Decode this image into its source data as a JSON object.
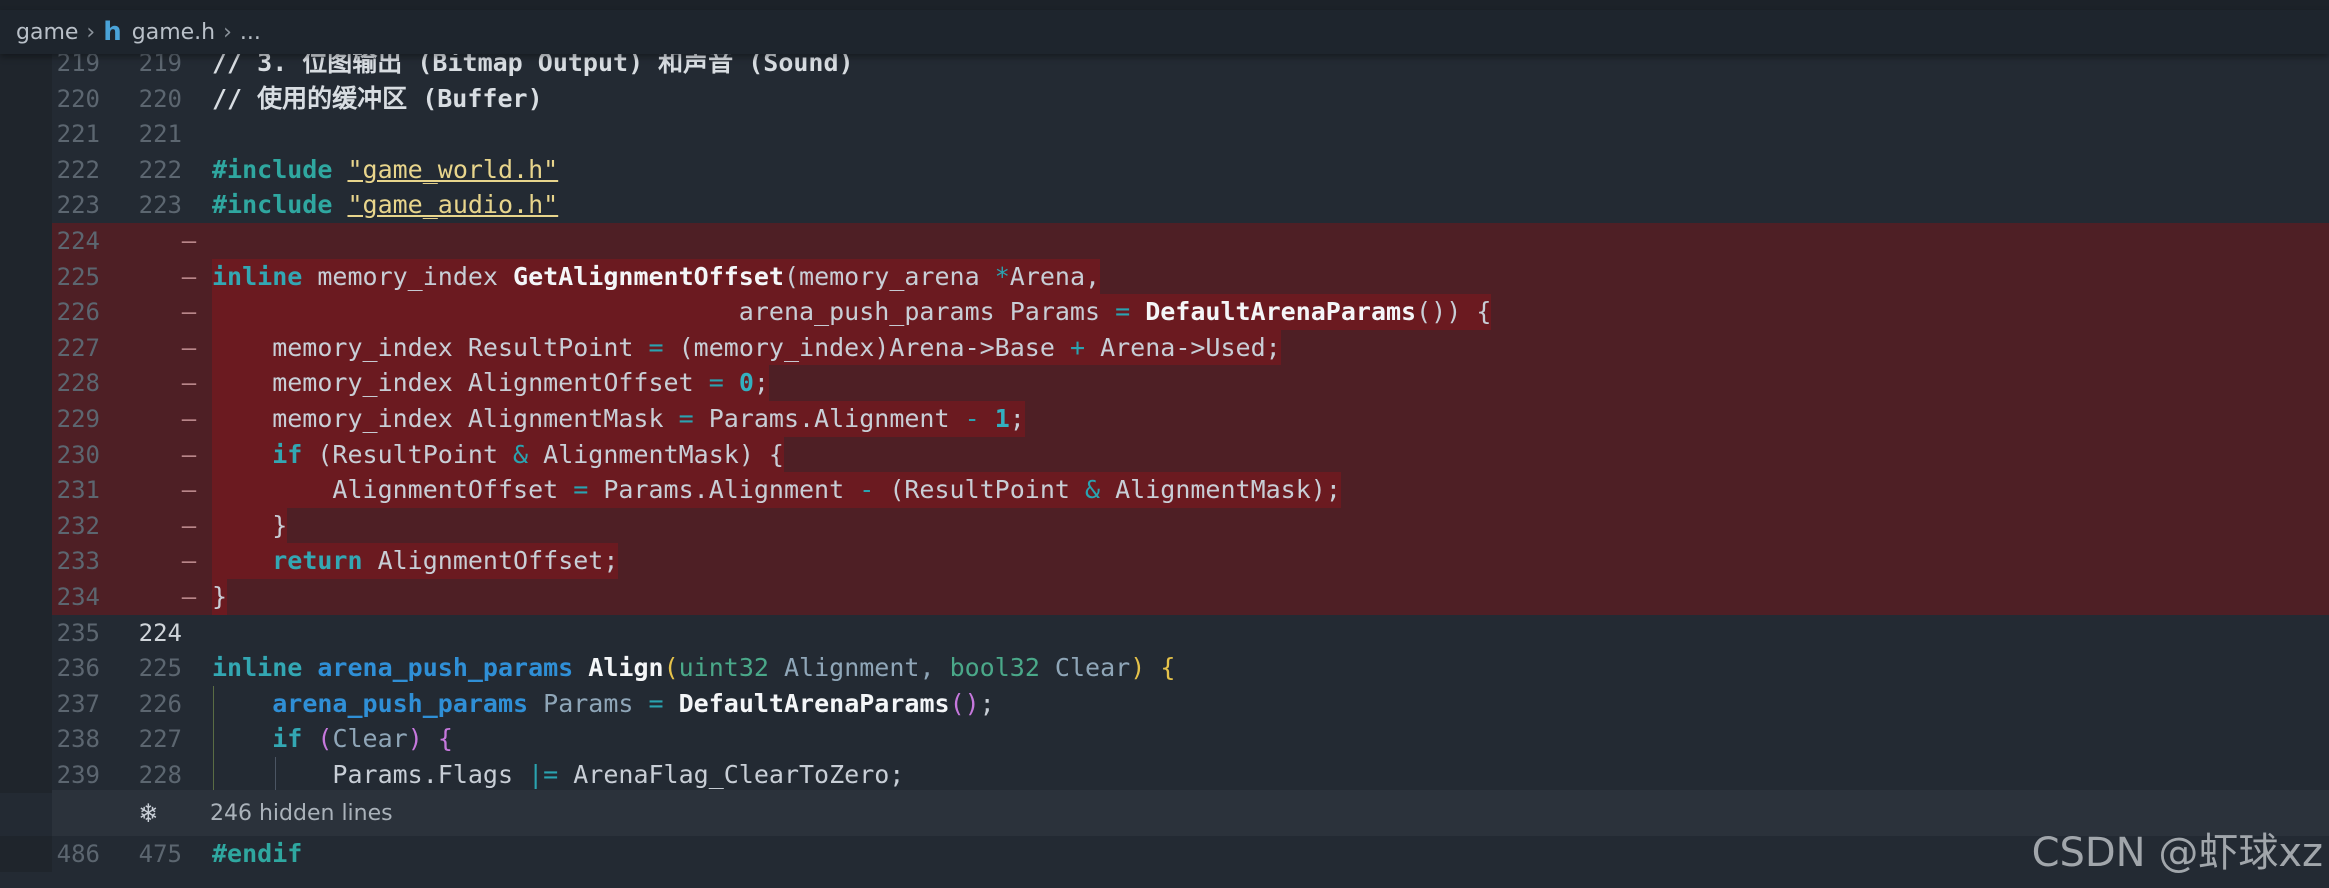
{
  "breadcrumb": {
    "folder": "game",
    "file_icon": "h",
    "file": "game.h",
    "ellipsis": "..."
  },
  "diff_lines": [
    {
      "old": "219",
      "new": "219",
      "type": "ctx",
      "tokens": [
        [
          "cm",
          "// 3. 位图输出 (Bitmap Output) 和声音 (Sound)"
        ]
      ]
    },
    {
      "old": "220",
      "new": "220",
      "type": "ctx",
      "tokens": [
        [
          "cm",
          "// 使用的缓冲区 (Buffer)"
        ]
      ]
    },
    {
      "old": "221",
      "new": "221",
      "type": "ctx",
      "tokens": []
    },
    {
      "old": "222",
      "new": "222",
      "type": "ctx",
      "tokens": [
        [
          "pp",
          "#include "
        ],
        [
          "str",
          "\"game_world.h\""
        ]
      ]
    },
    {
      "old": "223",
      "new": "223",
      "type": "ctx",
      "tokens": [
        [
          "pp",
          "#include "
        ],
        [
          "str",
          "\"game_audio.h\""
        ]
      ]
    },
    {
      "old": "224",
      "new": "—",
      "type": "del",
      "tokens": []
    },
    {
      "old": "225",
      "new": "—",
      "type": "del",
      "tokens": [
        [
          "kw",
          "inline "
        ],
        [
          "id",
          "memory_index "
        ],
        [
          "fn",
          "GetAlignmentOffset"
        ],
        [
          "id",
          "(memory_arena "
        ],
        [
          "op",
          "*"
        ],
        [
          "id",
          "Arena,"
        ]
      ]
    },
    {
      "old": "226",
      "new": "—",
      "type": "del",
      "tokens": [
        [
          "id",
          "                                   arena_push_params Params "
        ],
        [
          "op",
          "= "
        ],
        [
          "fn",
          "DefaultArenaParams"
        ],
        [
          "id",
          "()) {"
        ]
      ]
    },
    {
      "old": "227",
      "new": "—",
      "type": "del",
      "tokens": [
        [
          "id",
          "    memory_index ResultPoint "
        ],
        [
          "op",
          "= "
        ],
        [
          "id",
          "(memory_index)Arena->Base "
        ],
        [
          "op",
          "+ "
        ],
        [
          "id",
          "Arena->Used;"
        ]
      ]
    },
    {
      "old": "228",
      "new": "—",
      "type": "del",
      "tokens": [
        [
          "id",
          "    memory_index AlignmentOffset "
        ],
        [
          "op",
          "= "
        ],
        [
          "num",
          "0"
        ],
        [
          "id",
          ";"
        ]
      ]
    },
    {
      "old": "229",
      "new": "—",
      "type": "del",
      "tokens": [
        [
          "id",
          "    memory_index AlignmentMask "
        ],
        [
          "op",
          "= "
        ],
        [
          "id",
          "Params.Alignment "
        ],
        [
          "op",
          "- "
        ],
        [
          "num",
          "1"
        ],
        [
          "id",
          ";"
        ]
      ]
    },
    {
      "old": "230",
      "new": "—",
      "type": "del",
      "tokens": [
        [
          "id",
          "    "
        ],
        [
          "kw",
          "if "
        ],
        [
          "id",
          "(ResultPoint "
        ],
        [
          "op",
          "& "
        ],
        [
          "id",
          "AlignmentMask) {"
        ]
      ]
    },
    {
      "old": "231",
      "new": "—",
      "type": "del",
      "tokens": [
        [
          "id",
          "        AlignmentOffset "
        ],
        [
          "op",
          "= "
        ],
        [
          "id",
          "Params.Alignment "
        ],
        [
          "op",
          "- "
        ],
        [
          "id",
          "(ResultPoint "
        ],
        [
          "op",
          "& "
        ],
        [
          "id",
          "AlignmentMask);"
        ]
      ]
    },
    {
      "old": "232",
      "new": "—",
      "type": "del",
      "tokens": [
        [
          "id",
          "    }"
        ]
      ]
    },
    {
      "old": "233",
      "new": "—",
      "type": "del",
      "tokens": [
        [
          "id",
          "    "
        ],
        [
          "kw",
          "return "
        ],
        [
          "id",
          "AlignmentOffset;"
        ]
      ]
    },
    {
      "old": "234",
      "new": "—",
      "type": "del",
      "tokens": [
        [
          "id",
          "}"
        ]
      ]
    },
    {
      "old": "235",
      "new": "224",
      "type": "ctx",
      "current": true,
      "tokens": []
    },
    {
      "old": "236",
      "new": "225",
      "type": "ctx",
      "tokens": [
        [
          "kw",
          "inline "
        ],
        [
          "ty",
          "arena_push_params "
        ],
        [
          "fn",
          "Align"
        ],
        [
          "brk1",
          "("
        ],
        [
          "prim",
          "uint32 "
        ],
        [
          "param",
          "Alignment, "
        ],
        [
          "prim",
          "bool32 "
        ],
        [
          "param",
          "Clear"
        ],
        [
          "brk1",
          ")"
        ],
        [
          "id",
          " "
        ],
        [
          "brk1",
          "{"
        ]
      ]
    },
    {
      "old": "237",
      "new": "226",
      "type": "ctx",
      "tokens": [
        [
          "id",
          "    "
        ],
        [
          "ty",
          "arena_push_params "
        ],
        [
          "param",
          "Params "
        ],
        [
          "op",
          "= "
        ],
        [
          "fn",
          "DefaultArenaParams"
        ],
        [
          "brk2",
          "()"
        ],
        [
          "id",
          ";"
        ]
      ]
    },
    {
      "old": "238",
      "new": "227",
      "type": "ctx",
      "tokens": [
        [
          "id",
          "    "
        ],
        [
          "kw",
          "if "
        ],
        [
          "brk2",
          "("
        ],
        [
          "param",
          "Clear"
        ],
        [
          "brk2",
          ")"
        ],
        [
          "id",
          " "
        ],
        [
          "brk2",
          "{"
        ]
      ]
    },
    {
      "old": "239",
      "new": "228",
      "type": "ctx",
      "tokens": [
        [
          "id",
          "        Params.Flags "
        ],
        [
          "op",
          "|= "
        ],
        [
          "id",
          "ArenaFlag_ClearToZero;"
        ]
      ]
    }
  ],
  "hidden": {
    "icon": "❄",
    "icon_name": "unfold-icon",
    "label": "246 hidden lines"
  },
  "last_line": {
    "old": "486",
    "new": "475",
    "tokens": [
      [
        "pp",
        "#endif"
      ]
    ]
  },
  "watermark": "CSDN @虾球xz"
}
